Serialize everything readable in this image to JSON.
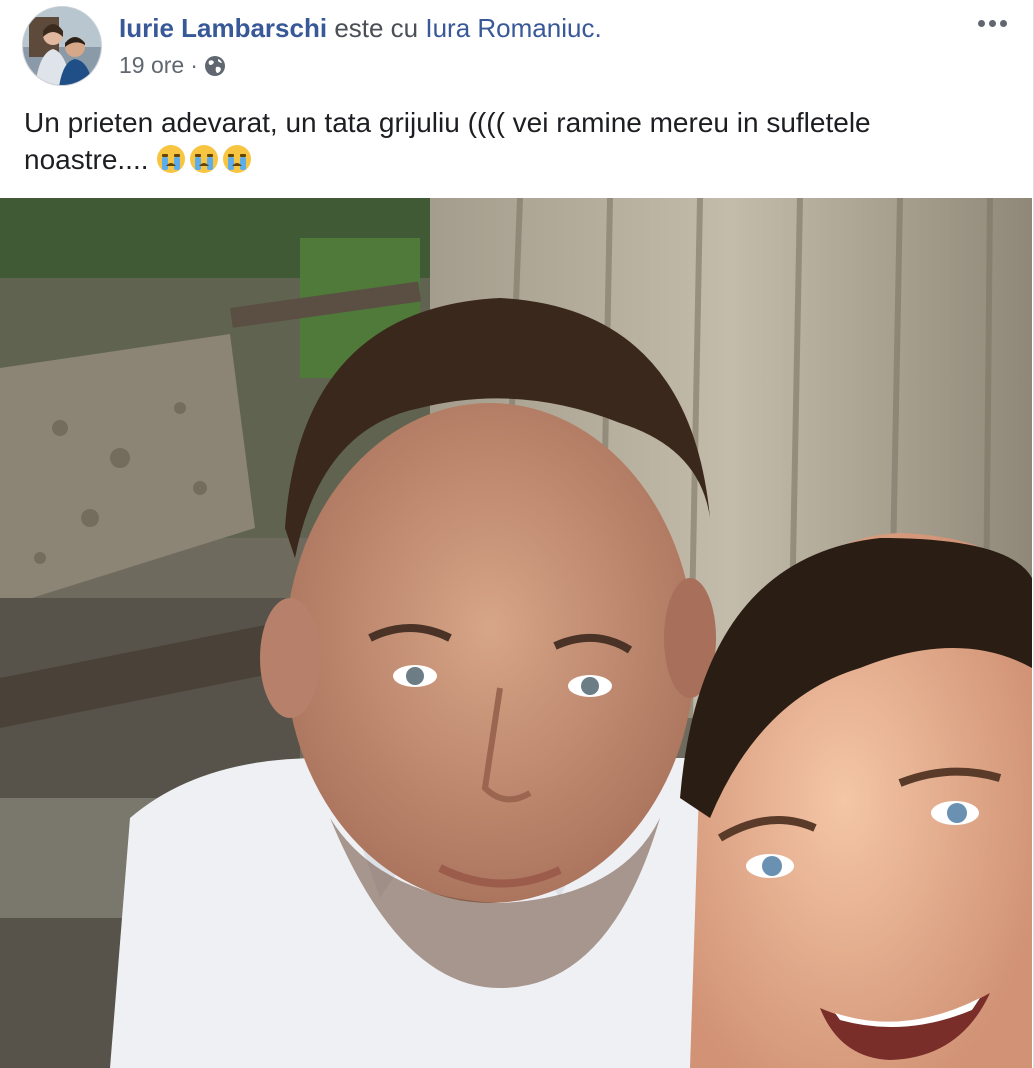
{
  "post": {
    "author_name": "Iurie Lambarschi",
    "with_text": "este cu",
    "tagged_name": "Iura Romaniuc.",
    "time_label": "19 ore",
    "separator": "·",
    "privacy_icon": "globe-icon",
    "more_icon": "more-options-icon",
    "message_line1": "Un prieten adevarat, un tata grijuliu (((( vei ramine mereu in sufletele",
    "message_line2": "noastre....",
    "emojis": [
      "crying-face-icon",
      "crying-face-icon",
      "crying-face-icon"
    ],
    "photo": "selfie-two-men-photo"
  },
  "colors": {
    "link": "#385898",
    "meta": "#606770",
    "text": "#1c1e21"
  }
}
